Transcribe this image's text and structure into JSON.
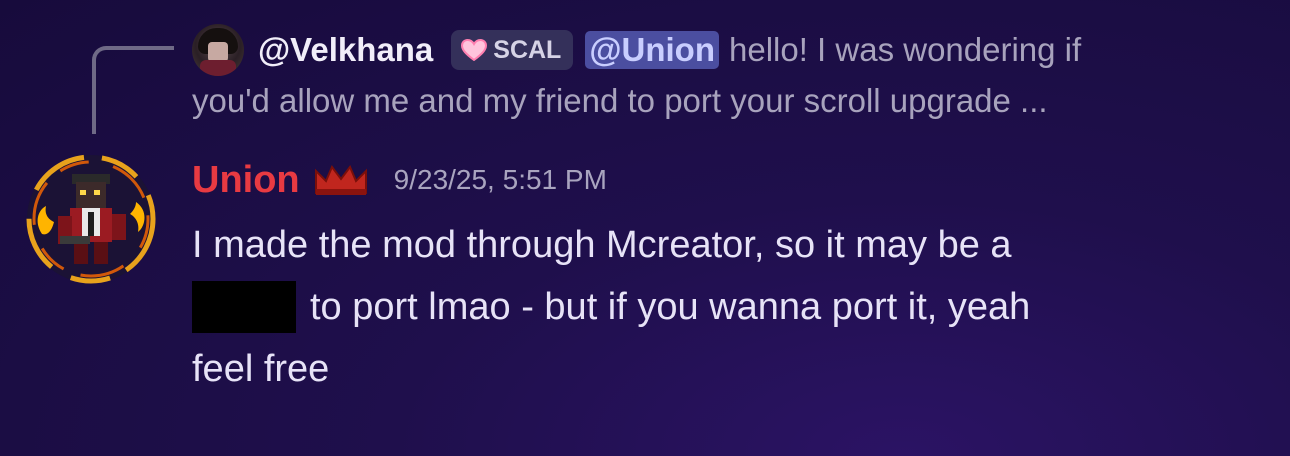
{
  "reply": {
    "author": "@Velkhana",
    "tag": "SCAL",
    "mention": "@Union",
    "text_line1": "hello! I was wondering if",
    "text_line2": "you'd allow me and my friend to port your scroll upgrade ..."
  },
  "message": {
    "author": "Union",
    "author_color": "#e83a42",
    "timestamp": "9/23/25, 5:51 PM",
    "line1": "I made the mod through Mcreator, so it may be a",
    "line2_after_redaction": "to port lmao - but if you wanna port it, yeah",
    "line3": "feel free"
  },
  "icons": {
    "tag_icon": "heart-icon",
    "role_icon": "crown-icon"
  },
  "colors": {
    "background": "#1f0f4c",
    "mention_bg": "#4b4ea0",
    "crown": "#c0261e"
  }
}
